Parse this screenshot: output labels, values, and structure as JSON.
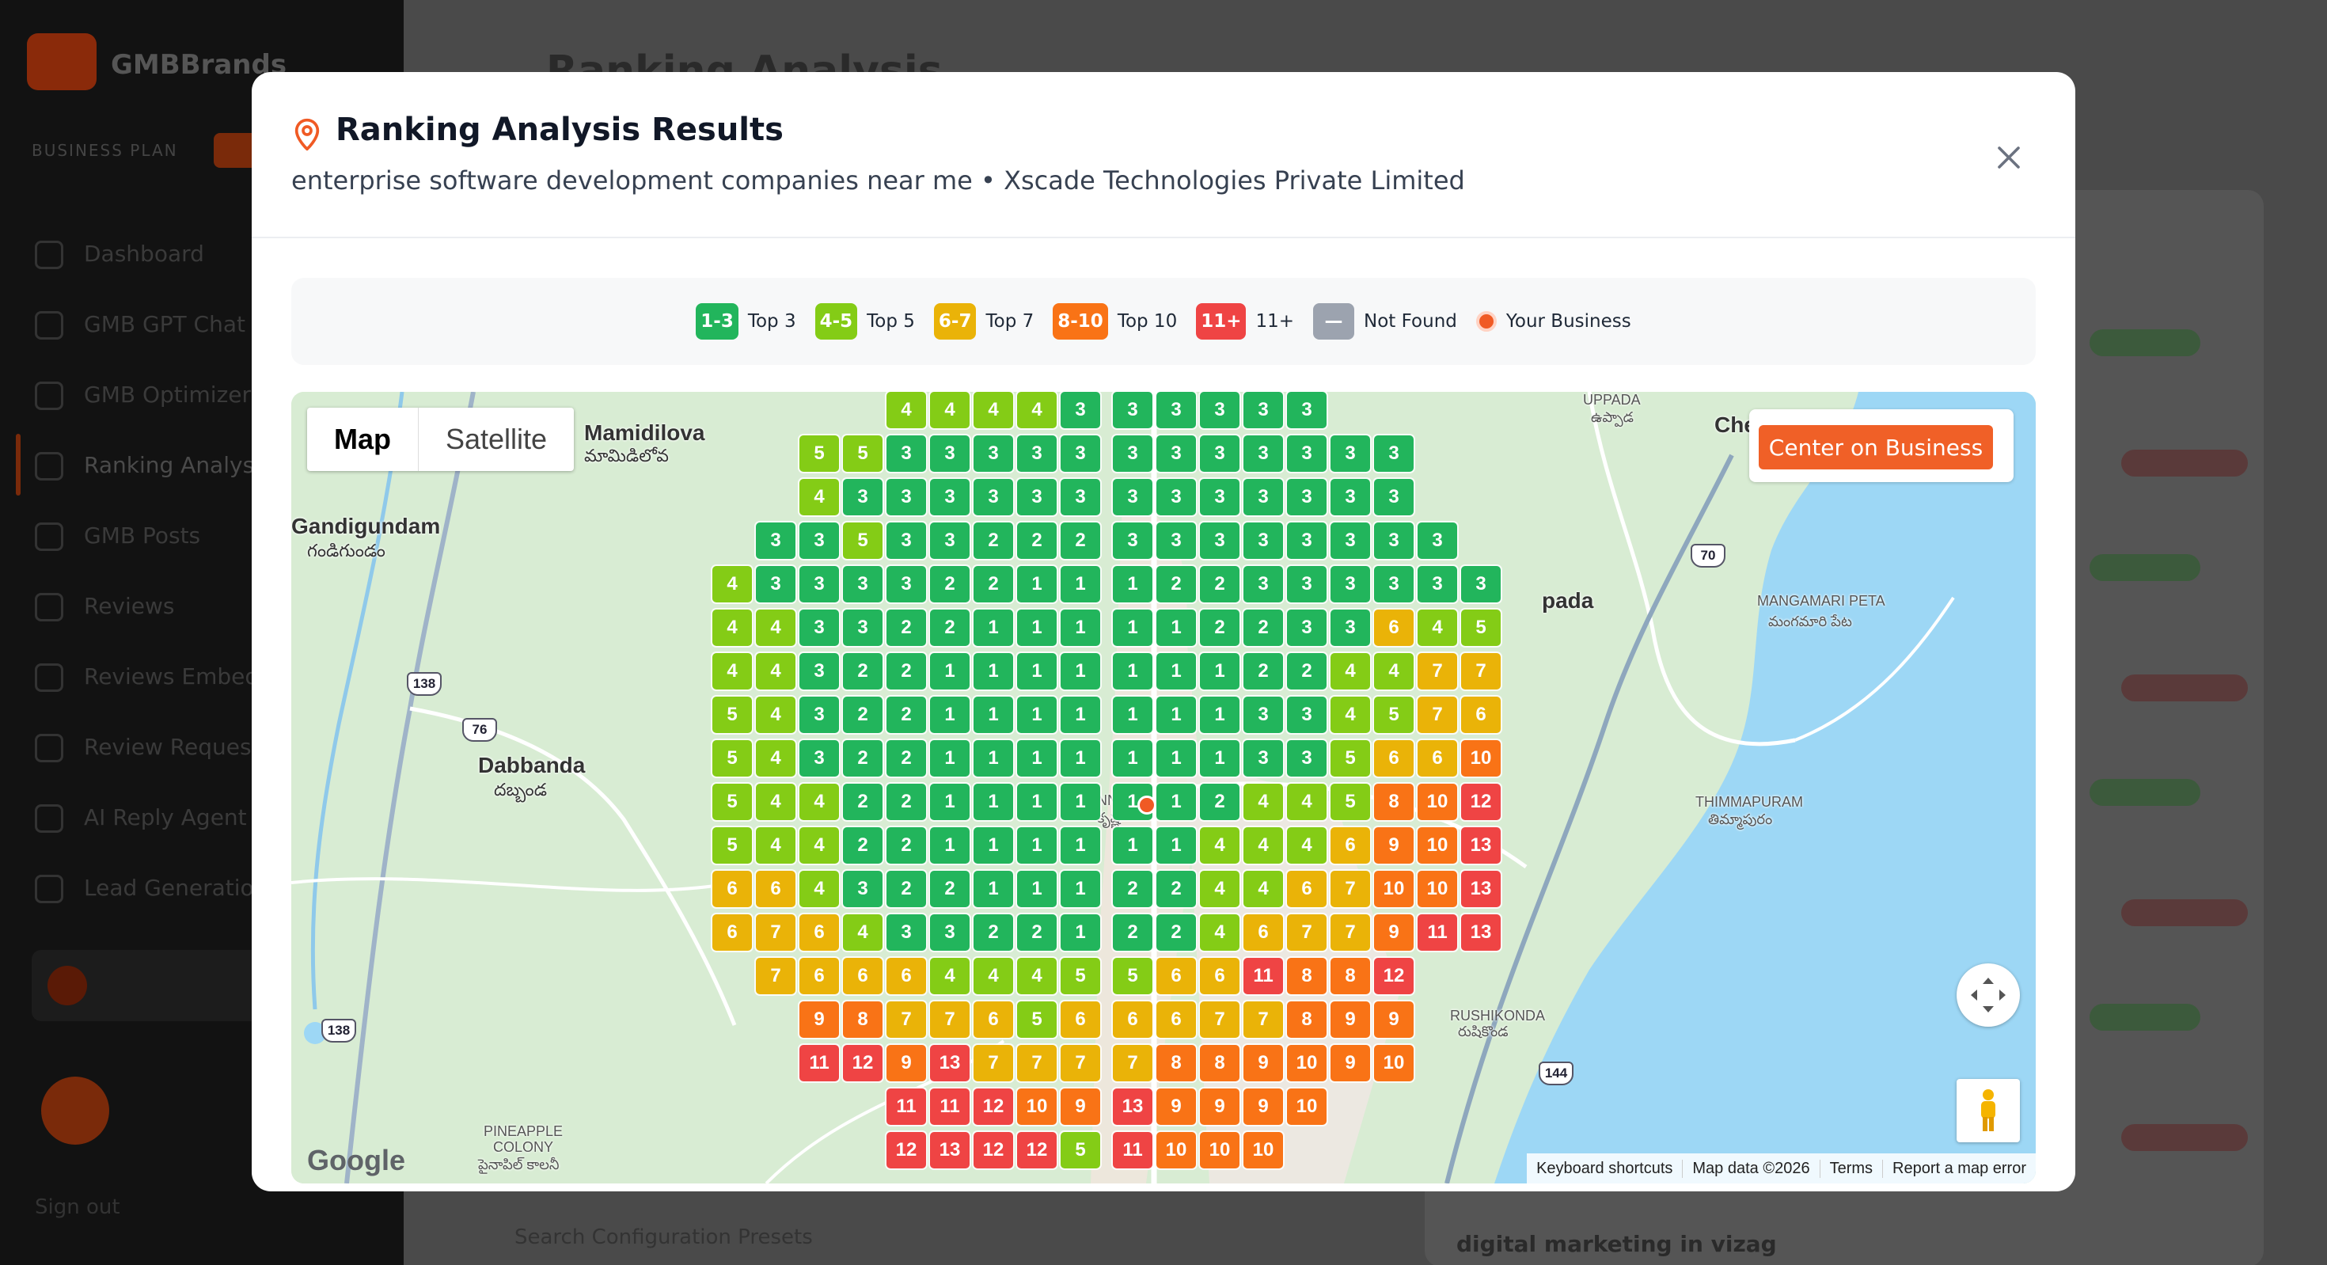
{
  "app": {
    "brand": "GMBBrands",
    "plan_label": "BUSINESS PLAN",
    "nav": [
      "Dashboard",
      "GMB GPT Chat",
      "GMB Optimizer",
      "Ranking Analysis",
      "GMB Posts",
      "Reviews",
      "Reviews Embed",
      "Review Request",
      "AI Reply Agent",
      "Lead Generation"
    ],
    "page_title": "Ranking Analysis",
    "bottom_left": "Search Configuration Presets",
    "bottom_right": "digital marketing in vizag",
    "sign_out": "Sign out"
  },
  "modal": {
    "title": "Ranking Analysis Results",
    "subtitle": "enterprise software development companies near me • Xscade Technologies Private Limited",
    "close_icon": "close-icon",
    "pin_icon": "map-pin-icon"
  },
  "colors": {
    "top3": "#22b55c",
    "top5": "#84cc16",
    "top7": "#eab308",
    "top10": "#f97316",
    "r11": "#ef4444",
    "notfound": "#9ca3af",
    "business": "#f05a24"
  },
  "legend": [
    {
      "badge": "1-3",
      "label": "Top 3",
      "color": "#22b55c"
    },
    {
      "badge": "4-5",
      "label": "Top 5",
      "color": "#84cc16"
    },
    {
      "badge": "6-7",
      "label": "Top 7",
      "color": "#eab308"
    },
    {
      "badge": "8-10",
      "label": "Top 10",
      "color": "#f97316"
    },
    {
      "badge": "11+",
      "label": "11+",
      "color": "#ef4444"
    },
    {
      "badge": "—",
      "label": "Not Found",
      "color": "#9ca3af"
    },
    {
      "dot": true,
      "label": "Your Business",
      "color": "#f05a24"
    }
  ],
  "map": {
    "type_options": [
      "Map",
      "Satellite"
    ],
    "selected_type": "Map",
    "center_button": "Center on Business",
    "google": "Google",
    "attribution": [
      "Keyboard shortcuts",
      "Map data ©2026",
      "Terms",
      "Report a map error"
    ],
    "labels": {
      "mamidilova": "Mamidilova",
      "mamidilova_te": "మామిడిలోవ",
      "gandigundam": "Gandigundam",
      "gandigundam_te": "గండిగుండం",
      "dabbanda": "Dabbanda",
      "dabbanda_te": "దబ్బండ",
      "uppada": "UPPADA",
      "uppada_te": "ఉప్పాడ",
      "che": "Che",
      "oada": "pada",
      "mangamari": "MANGAMARI PETA",
      "mangamari_te": "మంగమారి పేట",
      "thimmapuram": "THIMMAPURAM",
      "thimmapuram_te": "తిమ్మాపురం",
      "rushikonda": "RUSHIKONDA",
      "rushikonda_te": "రుషికొండ",
      "pineapple": "PINEAPPLE COLONY",
      "pineapple_te": "పైనాపిల్ కాలనీ",
      "kanna": "ANNA",
      "kanna_te": "కృష్ణ"
    },
    "shields": [
      "138",
      "76",
      "138",
      "70",
      "144"
    ],
    "grid_rows": [
      {
        "left": [
          "4",
          "4",
          "4",
          "4",
          "3"
        ],
        "right": [
          "3",
          "3",
          "3",
          "3",
          "3"
        ]
      },
      {
        "left": [
          "5",
          "5",
          "3",
          "3",
          "3",
          "3",
          "3"
        ],
        "right": [
          "3",
          "3",
          "3",
          "3",
          "3",
          "3",
          "3"
        ]
      },
      {
        "left": [
          "4",
          "3",
          "3",
          "3",
          "3",
          "3",
          "3"
        ],
        "right": [
          "3",
          "3",
          "3",
          "3",
          "3",
          "3",
          "3"
        ]
      },
      {
        "left": [
          "3",
          "3",
          "5",
          "3",
          "3",
          "2",
          "2",
          "2"
        ],
        "right": [
          "3",
          "3",
          "3",
          "3",
          "3",
          "3",
          "3",
          "3"
        ]
      },
      {
        "left": [
          "4",
          "3",
          "3",
          "3",
          "3",
          "2",
          "2",
          "1",
          "1"
        ],
        "right": [
          "1",
          "2",
          "2",
          "3",
          "3",
          "3",
          "3",
          "3",
          "3"
        ]
      },
      {
        "left": [
          "4",
          "4",
          "3",
          "3",
          "2",
          "2",
          "1",
          "1",
          "1"
        ],
        "right": [
          "1",
          "1",
          "2",
          "2",
          "3",
          "3",
          "6",
          "4",
          "5"
        ]
      },
      {
        "left": [
          "4",
          "4",
          "3",
          "2",
          "2",
          "1",
          "1",
          "1",
          "1"
        ],
        "right": [
          "1",
          "1",
          "1",
          "2",
          "2",
          "4",
          "4",
          "7",
          "7"
        ]
      },
      {
        "left": [
          "5",
          "4",
          "3",
          "2",
          "2",
          "1",
          "1",
          "1",
          "1"
        ],
        "right": [
          "1",
          "1",
          "1",
          "3",
          "3",
          "4",
          "5",
          "7",
          "6"
        ]
      },
      {
        "left": [
          "5",
          "4",
          "3",
          "2",
          "2",
          "1",
          "1",
          "1",
          "1"
        ],
        "right": [
          "1",
          "1",
          "1",
          "3",
          "3",
          "5",
          "6",
          "6",
          "10"
        ]
      },
      {
        "left": [
          "5",
          "4",
          "4",
          "2",
          "2",
          "1",
          "1",
          "1",
          "1"
        ],
        "right": [
          "1",
          "1",
          "2",
          "4",
          "4",
          "5",
          "8",
          "10",
          "12"
        ]
      },
      {
        "left": [
          "5",
          "4",
          "4",
          "2",
          "2",
          "1",
          "1",
          "1",
          "1"
        ],
        "right": [
          "1",
          "1",
          "4",
          "4",
          "4",
          "6",
          "9",
          "10",
          "13"
        ]
      },
      {
        "left": [
          "6",
          "6",
          "4",
          "3",
          "2",
          "2",
          "1",
          "1",
          "1"
        ],
        "right": [
          "2",
          "2",
          "4",
          "4",
          "6",
          "7",
          "10",
          "10",
          "13"
        ]
      },
      {
        "left": [
          "6",
          "7",
          "6",
          "4",
          "3",
          "3",
          "2",
          "2",
          "1"
        ],
        "right": [
          "2",
          "2",
          "4",
          "6",
          "7",
          "7",
          "9",
          "11",
          "13"
        ]
      },
      {
        "left": [
          "7",
          "6",
          "6",
          "6",
          "4",
          "4",
          "4",
          "5"
        ],
        "right": [
          "5",
          "6",
          "6",
          "11",
          "8",
          "8",
          "12"
        ]
      },
      {
        "left": [
          "9",
          "8",
          "7",
          "7",
          "6",
          "5",
          "6"
        ],
        "right": [
          "6",
          "6",
          "7",
          "7",
          "8",
          "9",
          "9"
        ]
      },
      {
        "left": [
          "11",
          "12",
          "9",
          "13",
          "7",
          "7",
          "7"
        ],
        "right": [
          "7",
          "8",
          "8",
          "9",
          "10",
          "9",
          "10"
        ]
      },
      {
        "left": [
          "11",
          "11",
          "12",
          "10",
          "9"
        ],
        "right": [
          "13",
          "9",
          "9",
          "9",
          "10"
        ]
      },
      {
        "left": [
          "12",
          "13",
          "12",
          "12",
          "5"
        ],
        "right": [
          "11",
          "10",
          "10",
          "10"
        ]
      }
    ]
  }
}
